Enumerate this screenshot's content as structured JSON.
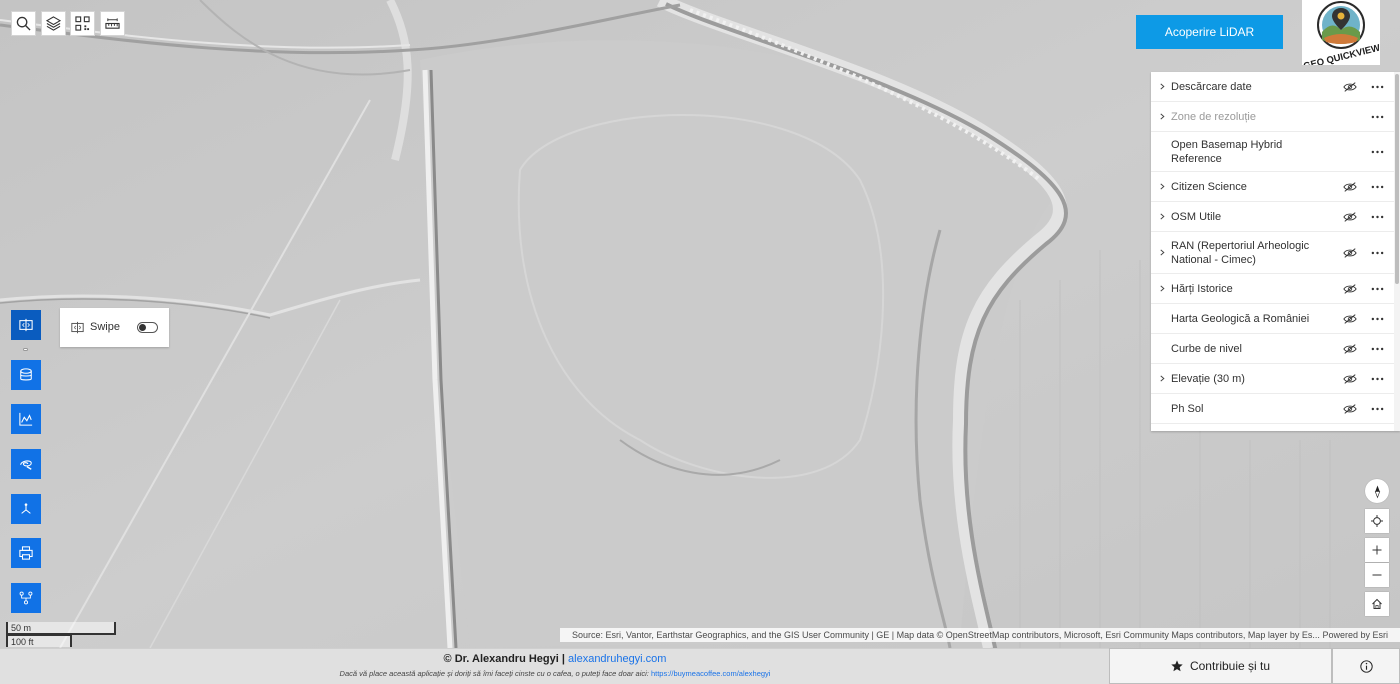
{
  "toolbar": {
    "buttons": [
      "search-icon",
      "layers-icon",
      "qr-code-icon",
      "measure-icon"
    ]
  },
  "lidar_button": "Acoperire LiDAR",
  "logo": {
    "text": "GEO QUICKVIEW"
  },
  "layers": [
    {
      "label": "Descărcare date",
      "expandable": true,
      "visible_toggle": true,
      "disabled": false
    },
    {
      "label": "Zone de rezoluție",
      "expandable": true,
      "visible_toggle": false,
      "disabled": true
    },
    {
      "label": "Open Basemap Hybrid Reference",
      "expandable": false,
      "visible_toggle": false,
      "disabled": false
    },
    {
      "label": "Citizen Science",
      "expandable": true,
      "visible_toggle": true,
      "disabled": false
    },
    {
      "label": "OSM Utile",
      "expandable": true,
      "visible_toggle": true,
      "disabled": false
    },
    {
      "label": "RAN (Repertoriul Arheologic National - Cimec)",
      "expandable": true,
      "visible_toggle": true,
      "disabled": false
    },
    {
      "label": "Hărți Istorice",
      "expandable": true,
      "visible_toggle": true,
      "disabled": false
    },
    {
      "label": "Harta Geologică a României",
      "expandable": false,
      "visible_toggle": true,
      "disabled": false
    },
    {
      "label": "Curbe de nivel",
      "expandable": false,
      "visible_toggle": true,
      "disabled": false
    },
    {
      "label": "Elevație (30 m)",
      "expandable": true,
      "visible_toggle": true,
      "disabled": false
    },
    {
      "label": "Ph Sol",
      "expandable": false,
      "visible_toggle": true,
      "disabled": false
    }
  ],
  "side_tools": [
    "swipe-icon",
    "database-icon",
    "elevation-profile-icon",
    "sketch-icon",
    "directions-icon",
    "print-icon",
    "network-icon"
  ],
  "swipe": {
    "label": "Swipe",
    "enabled": false
  },
  "map_controls": [
    "compass-icon",
    "locate-icon",
    "zoom-in-icon",
    "zoom-out-icon",
    "home-icon"
  ],
  "scalebar": {
    "metric": "50 m",
    "imperial": "100 ft"
  },
  "attribution": {
    "source": "Source: Esri, Vantor, Earthstar Geographics, and the GIS User Community | GE | Map data © OpenStreetMap contributors, Microsoft, Esri Community Maps contributors, Map layer by Es...",
    "powered": "Powered by Esri"
  },
  "footer": {
    "author": "© Dr. Alexandru Hegyi |",
    "author_link": "alexandruhegyi.com",
    "note": "Dacă vă place această aplicație și doriți să îmi faceți cinste cu o cafea, o puteți face doar aici:",
    "note_link": "https://buymeacoffee.com/alexhegyi",
    "contribute_label": "Contribuie și tu"
  },
  "colors": {
    "accent": "#1172e6",
    "lidar": "#0d9ae6",
    "link": "#1a73e8"
  }
}
